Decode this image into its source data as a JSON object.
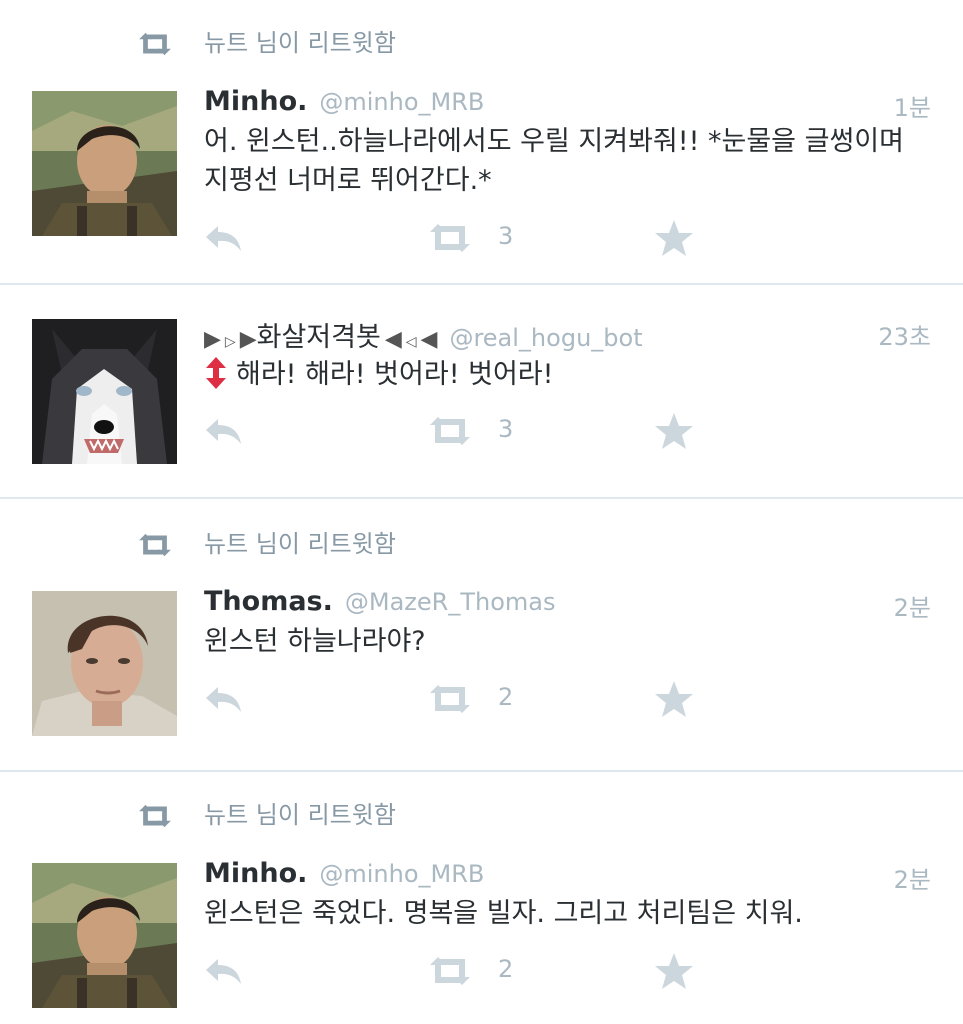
{
  "retweet_notice": "뉴트 님이 리트윗함",
  "tweets": [
    {
      "name": "Minho.",
      "handle": "@minho_MRB",
      "time": "1분",
      "text_line1": "어. 윈스턴..하늘나라에서도 우릴 지켜봐줘!! *눈물을 글썽이며",
      "text_line2": "지평선 너머로 뛰어간다.*",
      "retweet_count": "3",
      "retweeted_by_notice": true,
      "avatar": "minho-avatar"
    },
    {
      "name": "화살저격봇",
      "handle": "@real_hogu_bot",
      "time": "23초",
      "text": "해라! 해라! 벗어라! 벗어라!",
      "retweet_count": "3",
      "retweeted_by_notice": false,
      "avatar": "husky-avatar"
    },
    {
      "name": "Thomas.",
      "handle": "@MazeR_Thomas",
      "time": "2분",
      "text": "윈스턴 하늘나라야?",
      "retweet_count": "2",
      "retweeted_by_notice": true,
      "avatar": "thomas-avatar"
    },
    {
      "name": "Minho.",
      "handle": "@minho_MRB",
      "time": "2분",
      "text": "윈스턴은 죽었다. 명복을 빌자. 그리고 처리팀은 치워.",
      "retweet_count": "2",
      "retweeted_by_notice": true,
      "avatar": "minho-avatar"
    }
  ],
  "colors": {
    "divider": "#e1e8ed",
    "meta_text": "#aab8c2",
    "retweet_notice_text": "#8899a6",
    "action_icon": "#ccd6dd",
    "retweet_notice_icon": "#8899a6",
    "arrow_red": "#dd2e44"
  },
  "icons": {
    "retweet": "retweet-icon",
    "reply": "reply-icon",
    "favorite": "star-icon",
    "updown_arrow": "up-down-arrow-icon"
  }
}
